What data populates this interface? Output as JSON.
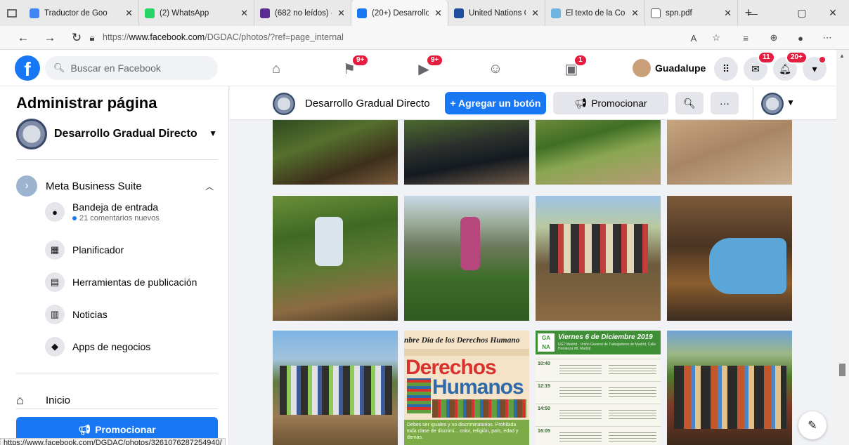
{
  "browser": {
    "tabs": [
      {
        "title": "Traductor de Goo",
        "favicon_color": "#4285f4",
        "active": false
      },
      {
        "title": "(2) WhatsApp",
        "favicon_color": "#25d366",
        "active": false
      },
      {
        "title": "(682 no leídos) -",
        "favicon_color": "#5c2d91",
        "active": false
      },
      {
        "title": "(20+) Desarrollo",
        "favicon_color": "#1877f2",
        "active": true
      },
      {
        "title": "United Nations C",
        "favicon_color": "#1f4e9c",
        "active": false
      },
      {
        "title": "El texto de la Cor",
        "favicon_color": "#6fb3e0",
        "active": false
      },
      {
        "title": "spn.pdf",
        "favicon_color": "#ffffff",
        "active": false
      }
    ],
    "url_prefix": "https://",
    "url_host": "www.facebook.com",
    "url_path": "/DGDAC/photos/?ref=page_internal",
    "status_url": "https://www.facebook.com/DGDAC/photos/3261076287254940/"
  },
  "fb": {
    "search_placeholder": "Buscar en Facebook",
    "badges": {
      "pages": "9+",
      "watch": "9+",
      "gaming": "1",
      "messenger": "11",
      "notifications": "20+"
    },
    "user_name": "Guadalupe"
  },
  "left": {
    "title": "Administrar página",
    "page_name": "Desarrollo Gradual Directo",
    "mbs_label": "Meta Business Suite",
    "items": [
      {
        "label": "Bandeja de entrada",
        "secondary": "21 comentarios nuevos",
        "icon": "chat-bubble-icon"
      },
      {
        "label": "Planificador",
        "secondary": "",
        "icon": "calendar-icon"
      },
      {
        "label": "Herramientas de publicación",
        "secondary": "",
        "icon": "publishing-tools-icon"
      },
      {
        "label": "Noticias",
        "secondary": "",
        "icon": "news-icon"
      },
      {
        "label": "Apps de negocios",
        "secondary": "",
        "icon": "business-apps-icon"
      }
    ],
    "inicio": "Inicio",
    "promote": "Promocionar"
  },
  "header": {
    "page_name": "Desarrollo Gradual Directo",
    "add_button": "+ Agregar un botón",
    "promote": "Promocionar"
  },
  "posters": {
    "derechos_heading": "nbre Día de los Derechos Humano",
    "derechos_big1": "Derechos",
    "derechos_big2": "Humanos",
    "derechos_text": "Debes ser iguales y no discriminatorios. Prohibida toda clase de discrimi... color, religión, país, edad y demás.",
    "event_date": "Viernes 6 de Diciembre 2019",
    "event_place": "UGT Madrid - Unión General de Trabajadores de Madrid, Calle Hortaleza 88, Madrid",
    "event_times": [
      "10:40",
      "12:15",
      "14:50",
      "16:05"
    ]
  }
}
